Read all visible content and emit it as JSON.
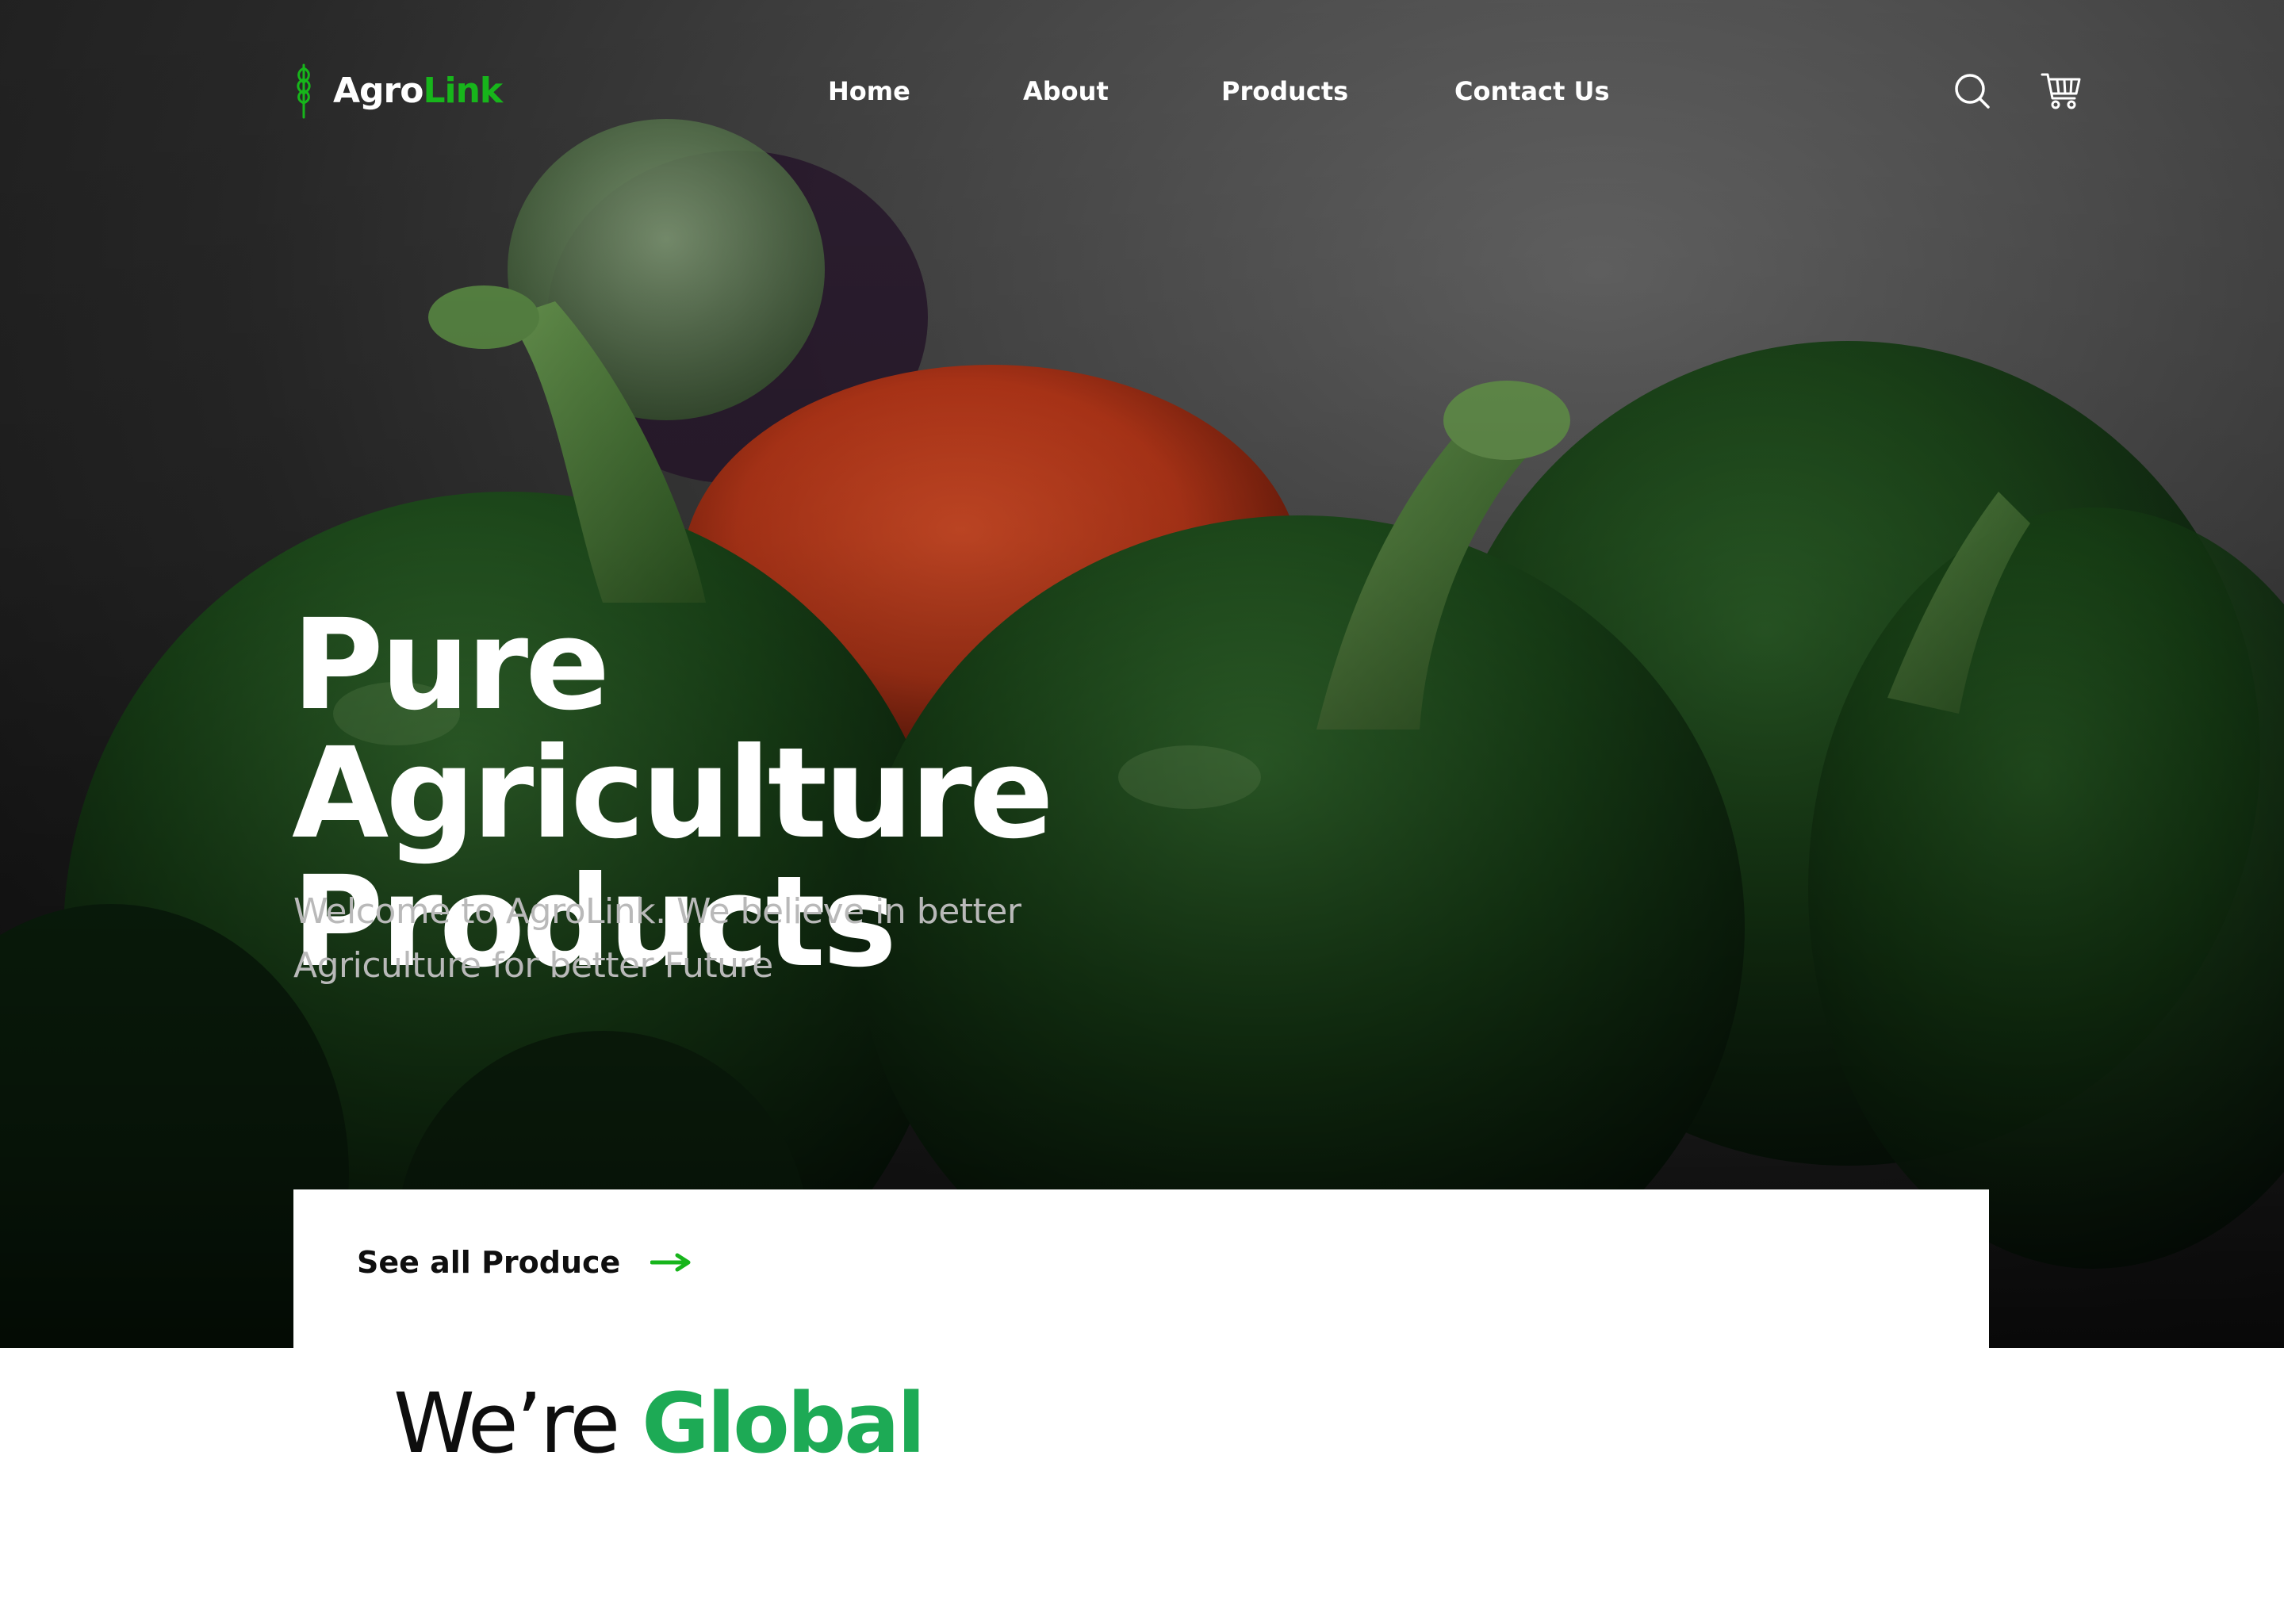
{
  "brand": {
    "name_part1": "Agro",
    "name_part2": "Link",
    "accent_color": "#17b51b",
    "logo_icon": "wheat-icon"
  },
  "nav": {
    "items": [
      {
        "label": "Home"
      },
      {
        "label": "About"
      },
      {
        "label": "Products"
      },
      {
        "label": "Contact Us"
      }
    ]
  },
  "header_icons": {
    "search": "search-icon",
    "cart": "cart-icon"
  },
  "hero": {
    "title_line1": "Pure Agriculture",
    "title_line2": "Products",
    "subtitle_line1": "Welcome to AgroLink. We believe in better",
    "subtitle_line2": "Agriculture for better Future"
  },
  "cta": {
    "label": "See all Produce",
    "icon": "arrow-right-icon",
    "arrow_color": "#17b51b"
  },
  "section": {
    "title_plain": "We’re ",
    "title_accent": "Global",
    "accent_color": "#1daa55"
  }
}
